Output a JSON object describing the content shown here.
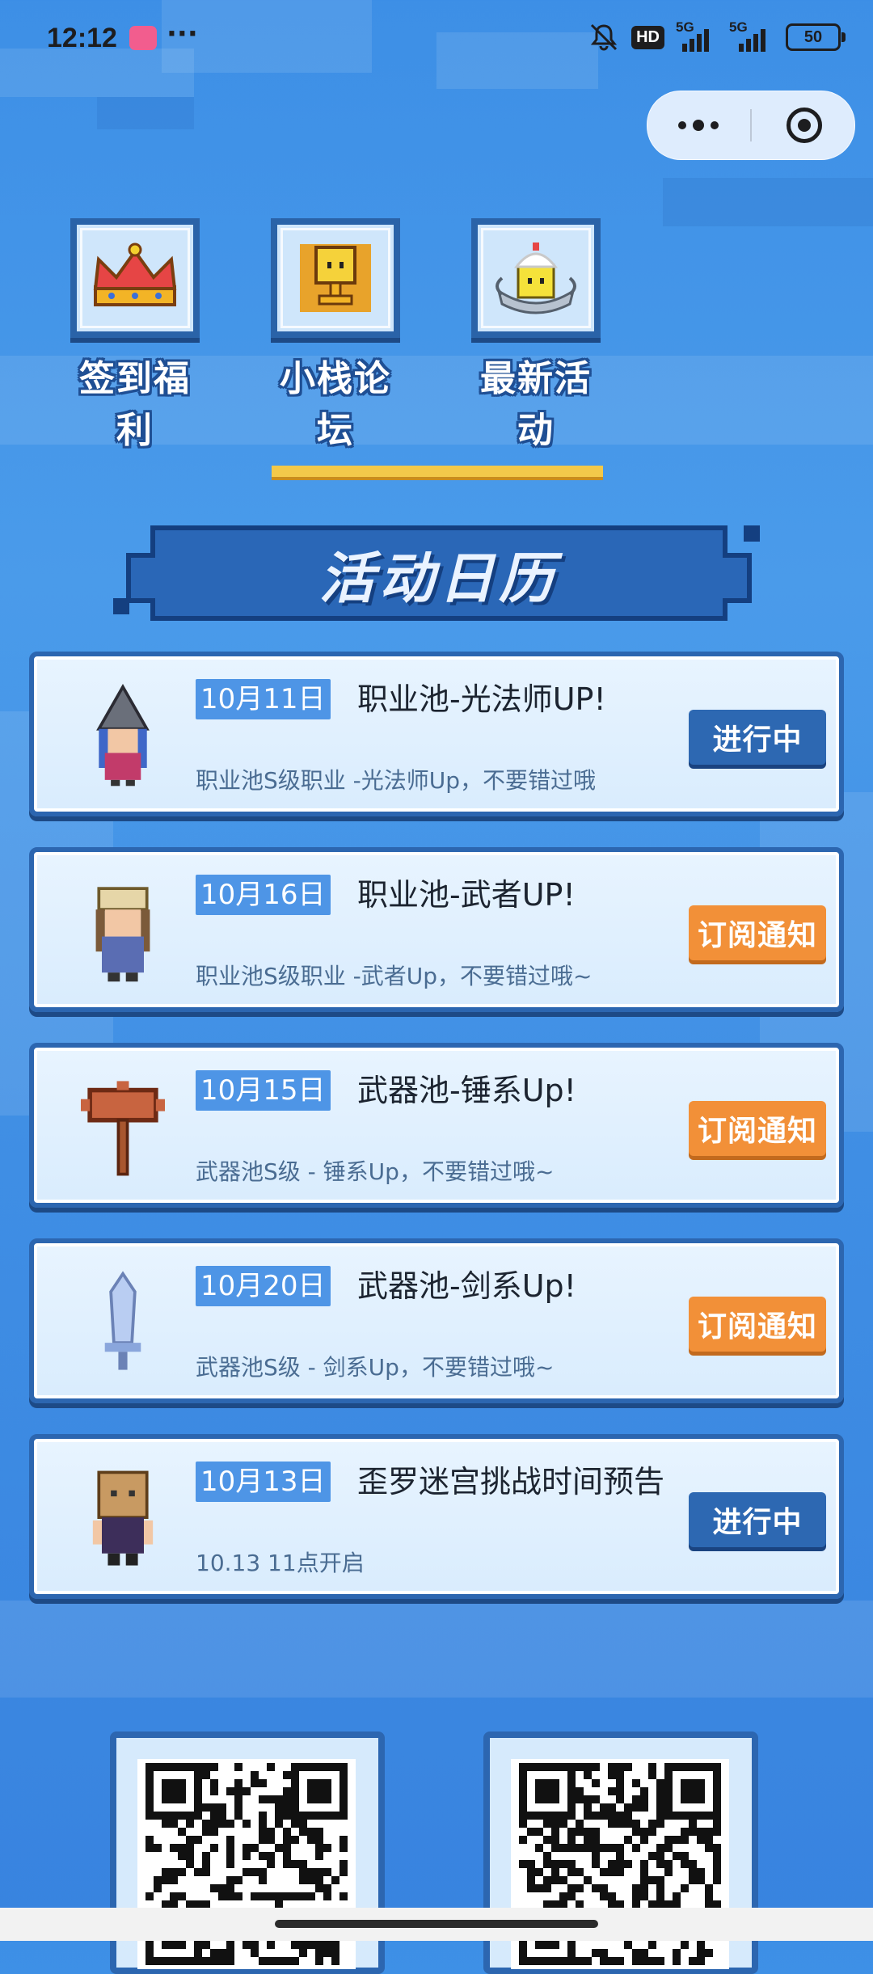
{
  "status_bar": {
    "time": "12:12",
    "dots": "···",
    "hd": "HD",
    "net1": "5G",
    "net2": "5G",
    "battery": "50"
  },
  "nav": [
    {
      "label": "签到福利",
      "icon": "crown-icon"
    },
    {
      "label": "小栈论坛",
      "icon": "trophy-icon"
    },
    {
      "label": "最新活动",
      "icon": "cake-icon"
    }
  ],
  "calendar": {
    "title": "活动日历",
    "events": [
      {
        "date": "10月11日",
        "title": "职业池-光法师UP!",
        "desc": "职业池S级职业 -光法师Up，不要错过哦",
        "button": "进行中",
        "button_style": "blue",
        "avatar": "wizard-avatar-icon"
      },
      {
        "date": "10月16日",
        "title": "职业池-武者UP!",
        "desc": "职业池S级职业 -武者Up，不要错过哦~",
        "button": "订阅通知",
        "button_style": "orange",
        "avatar": "warrior-avatar-icon"
      },
      {
        "date": "10月15日",
        "title": "武器池-锤系Up!",
        "desc": "武器池S级 - 锤系Up，不要错过哦~",
        "button": "订阅通知",
        "button_style": "orange",
        "avatar": "hammer-icon"
      },
      {
        "date": "10月20日",
        "title": "武器池-剑系Up!",
        "desc": "武器池S级 - 剑系Up，不要错过哦~",
        "button": "订阅通知",
        "button_style": "orange",
        "avatar": "sword-icon"
      },
      {
        "date": "10月13日",
        "title": "歪罗迷宫挑战时间预告",
        "desc": "10.13 11点开启",
        "button": "进行中",
        "button_style": "blue",
        "avatar": "boxhead-avatar-icon"
      }
    ]
  },
  "colors": {
    "accent_blue": "#2d68b2",
    "accent_orange": "#f29038",
    "date_tag": "#4e95e6"
  }
}
